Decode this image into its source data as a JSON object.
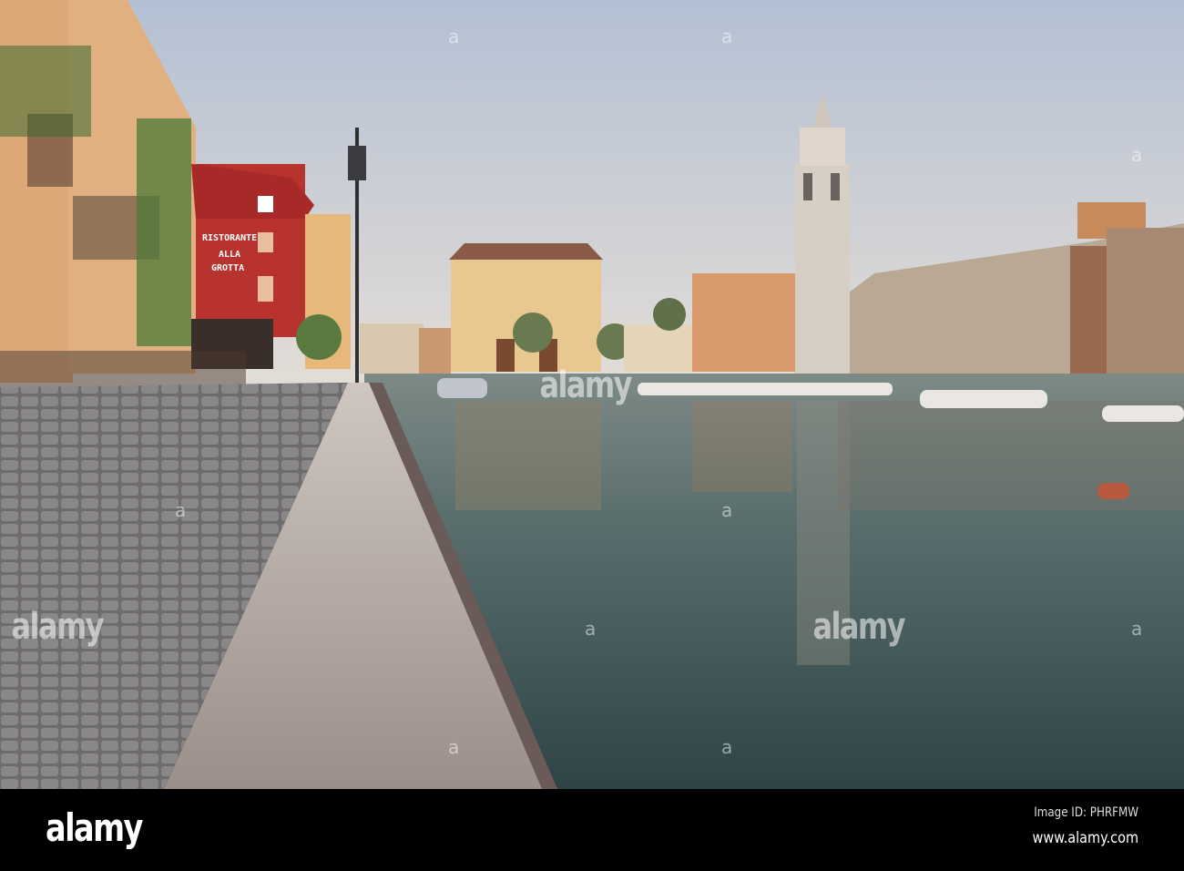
{
  "photo": {
    "sign_lines": [
      "RISTORANTE",
      "ALLA",
      "GROTTA"
    ],
    "watermark": "alamy",
    "watermark_mark": "a"
  },
  "footer": {
    "logo": "alamy",
    "image_id": "Image ID: PHRFMW",
    "website": "www.alamy.com"
  },
  "colors": {
    "sky_top": "#b3c0d4",
    "sky_bottom": "#e4ddd6",
    "water": "#4d6466",
    "red_building": "#b8332e"
  }
}
